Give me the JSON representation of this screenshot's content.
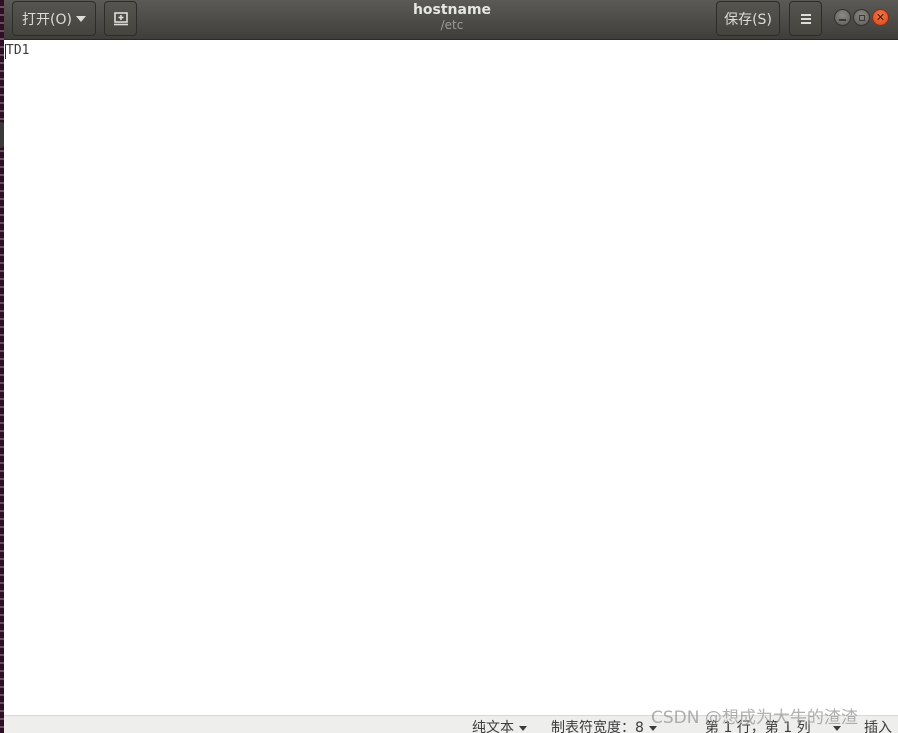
{
  "header": {
    "open_label": "打开(O)",
    "title": "hostname",
    "subtitle": "/etc",
    "save_label": "保存(S)",
    "newtab_icon": "new-document-icon",
    "menu_icon": "hamburger-menu-icon"
  },
  "window_controls": {
    "minimize_icon": "minimize-icon",
    "maximize_icon": "maximize-icon",
    "close_icon": "close-icon",
    "close_color": "#e0501f"
  },
  "editor": {
    "content": "TD1"
  },
  "statusbar": {
    "syntax_label": "纯文本",
    "tab_width_label": "制表符宽度：8",
    "position_label": "第 1 行，第 1 列",
    "mode_label": "插入"
  },
  "watermark": "CSDN @想成为大牛的渣渣"
}
